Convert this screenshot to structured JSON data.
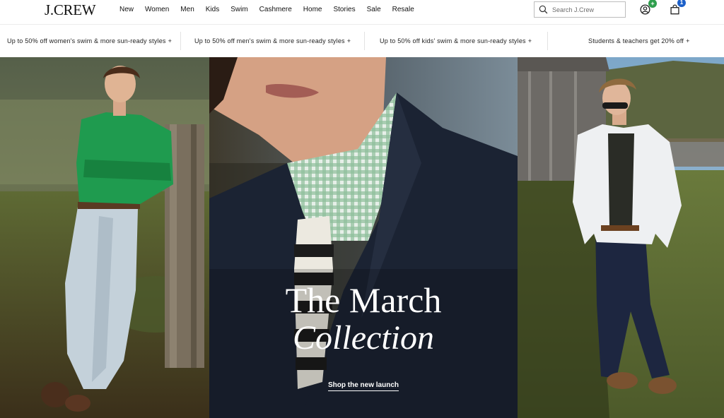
{
  "brand": {
    "logo": "J.CREW"
  },
  "nav": {
    "items": [
      "New",
      "Women",
      "Men",
      "Kids",
      "Swim",
      "Cashmere",
      "Home",
      "Stories",
      "Sale",
      "Resale"
    ]
  },
  "search": {
    "placeholder": "Search J.Crew"
  },
  "account": {
    "badge": "+"
  },
  "bag": {
    "count": "1"
  },
  "promos": [
    {
      "text": "Up to 50% off women's swim & more sun-ready styles",
      "mark": "+"
    },
    {
      "text": "Up to 50% off men's swim & more sun-ready styles",
      "mark": "+"
    },
    {
      "text": "Up to 50% off kids' swim & more sun-ready styles",
      "mark": "+"
    },
    {
      "text": "Students & teachers get 20% off",
      "mark": "+"
    }
  ],
  "hero": {
    "title_line1": "The March",
    "title_line2": "Collection",
    "cta": "Shop the new launch"
  },
  "colors": {
    "account_badge": "#2e9e4c",
    "bag_badge": "#1d60c9",
    "shirt_green": "#1f9b4f",
    "jacket_navy": "#1b2333"
  },
  "icons": {
    "search": "search-icon",
    "account": "account-icon",
    "bag": "shopping-bag-icon"
  }
}
